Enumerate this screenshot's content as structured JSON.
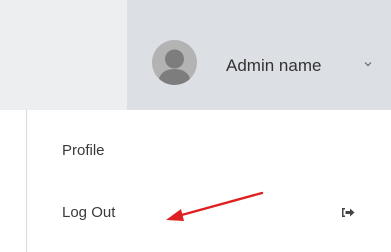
{
  "header": {
    "account_name": "Admin name",
    "avatar_icon": "user-silhouette-icon",
    "caret_icon": "chevron-down-icon"
  },
  "menu": {
    "items": [
      {
        "label": "Profile"
      },
      {
        "label": "Log Out",
        "icon": "sign-out-icon"
      }
    ]
  },
  "annotation": {
    "arrow_color": "#e02020"
  }
}
